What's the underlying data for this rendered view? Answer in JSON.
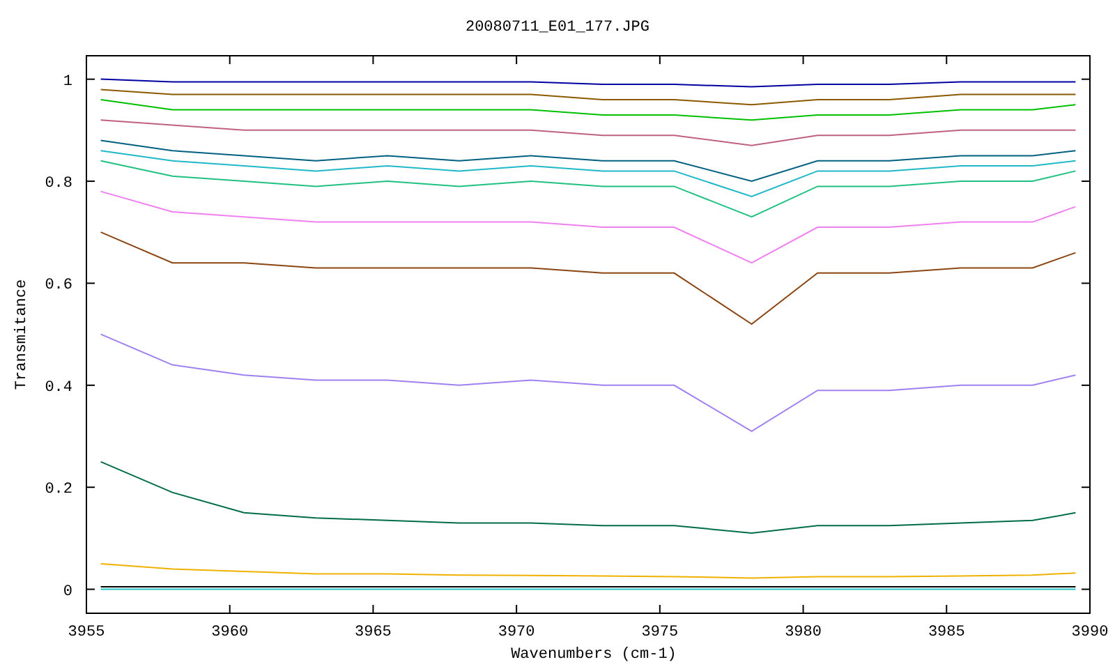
{
  "chart_data": {
    "type": "line",
    "title": "20080711_E01_177.JPG",
    "xlabel": "Wavenumbers (cm-1)",
    "ylabel": "Transmitance",
    "x": [
      3955.5,
      3958,
      3960.5,
      3963,
      3965.5,
      3968,
      3970.5,
      3973,
      3975.5,
      3978.2,
      3980.5,
      3983,
      3985.5,
      3988,
      3989.5
    ],
    "series": [
      {
        "color": "#000000",
        "values": [
          0.005,
          0.005,
          0.005,
          0.005,
          0.005,
          0.005,
          0.005,
          0.005,
          0.005,
          0.005,
          0.005,
          0.005,
          0.005,
          0.005,
          0.005
        ]
      },
      {
        "color": "#20c0c0",
        "values": [
          0,
          0,
          0,
          0,
          0,
          0,
          0,
          0,
          0,
          0,
          0,
          0,
          0,
          0,
          0
        ]
      },
      {
        "color": "#f0b000",
        "values": [
          0.05,
          0.04,
          0.035,
          0.03,
          0.03,
          0.028,
          0.027,
          0.026,
          0.025,
          0.022,
          0.025,
          0.025,
          0.026,
          0.028,
          0.032
        ]
      },
      {
        "color": "#006d46",
        "values": [
          0.25,
          0.19,
          0.15,
          0.14,
          0.135,
          0.13,
          0.13,
          0.125,
          0.125,
          0.11,
          0.125,
          0.125,
          0.13,
          0.135,
          0.15
        ]
      },
      {
        "color": "#a080f0",
        "values": [
          0.5,
          0.44,
          0.42,
          0.41,
          0.41,
          0.4,
          0.41,
          0.4,
          0.4,
          0.31,
          0.39,
          0.39,
          0.4,
          0.4,
          0.42
        ]
      },
      {
        "color": "#8b4513",
        "values": [
          0.7,
          0.64,
          0.64,
          0.63,
          0.63,
          0.63,
          0.63,
          0.62,
          0.62,
          0.52,
          0.62,
          0.62,
          0.63,
          0.63,
          0.66
        ]
      },
      {
        "color": "#f080f0",
        "values": [
          0.78,
          0.74,
          0.73,
          0.72,
          0.72,
          0.72,
          0.72,
          0.71,
          0.71,
          0.64,
          0.71,
          0.71,
          0.72,
          0.72,
          0.75
        ]
      },
      {
        "color": "#20c080",
        "values": [
          0.84,
          0.81,
          0.8,
          0.79,
          0.8,
          0.79,
          0.8,
          0.79,
          0.79,
          0.73,
          0.79,
          0.79,
          0.8,
          0.8,
          0.82
        ]
      },
      {
        "color": "#20b8c8",
        "values": [
          0.86,
          0.84,
          0.83,
          0.82,
          0.83,
          0.82,
          0.83,
          0.82,
          0.82,
          0.77,
          0.82,
          0.82,
          0.83,
          0.83,
          0.84
        ]
      },
      {
        "color": "#006080",
        "values": [
          0.88,
          0.86,
          0.85,
          0.84,
          0.85,
          0.84,
          0.85,
          0.84,
          0.84,
          0.8,
          0.84,
          0.84,
          0.85,
          0.85,
          0.86
        ]
      },
      {
        "color": "#c06080",
        "values": [
          0.92,
          0.91,
          0.9,
          0.9,
          0.9,
          0.9,
          0.9,
          0.89,
          0.89,
          0.87,
          0.89,
          0.89,
          0.9,
          0.9,
          0.9
        ]
      },
      {
        "color": "#00c000",
        "values": [
          0.96,
          0.94,
          0.94,
          0.94,
          0.94,
          0.94,
          0.94,
          0.93,
          0.93,
          0.92,
          0.93,
          0.93,
          0.94,
          0.94,
          0.95
        ]
      },
      {
        "color": "#8b5a00",
        "values": [
          0.98,
          0.97,
          0.97,
          0.97,
          0.97,
          0.97,
          0.97,
          0.96,
          0.96,
          0.95,
          0.96,
          0.96,
          0.97,
          0.97,
          0.97
        ]
      },
      {
        "color": "#0000a0",
        "values": [
          1,
          0.995,
          0.995,
          0.995,
          0.995,
          0.995,
          0.995,
          0.99,
          0.99,
          0.985,
          0.99,
          0.99,
          0.995,
          0.995,
          0.995
        ]
      }
    ],
    "xlim": [
      3955,
      3990
    ],
    "ylim": [
      -0.047,
      1.046
    ],
    "xticks": [
      3955,
      3960,
      3965,
      3970,
      3975,
      3980,
      3985,
      3990
    ],
    "yticks": [
      0,
      0.2,
      0.4,
      0.6,
      0.8,
      1
    ]
  }
}
